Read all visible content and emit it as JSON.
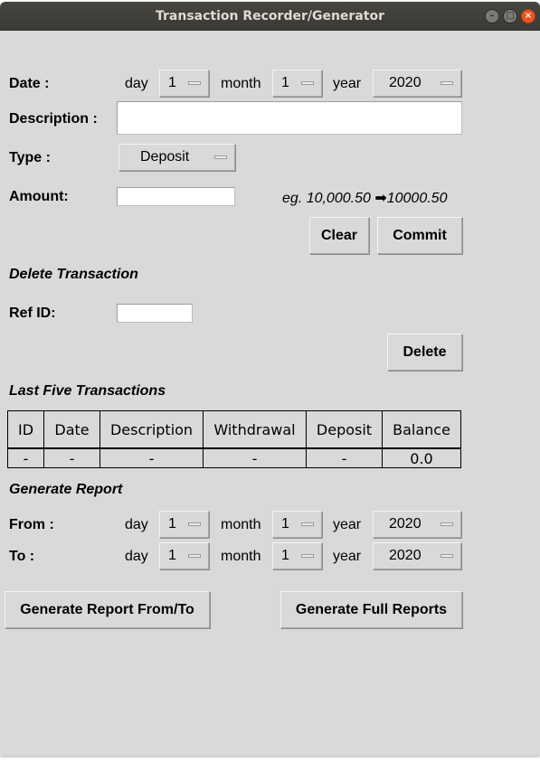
{
  "window": {
    "title": "Transaction Recorder/Generator"
  },
  "date_row": {
    "label": "Date :",
    "day_label": "day",
    "day_value": "1",
    "month_label": "month",
    "month_value": "1",
    "year_label": "year",
    "year_value": "2020"
  },
  "description": {
    "label": "Description :",
    "value": ""
  },
  "type": {
    "label": "Type :",
    "value": "Deposit"
  },
  "amount": {
    "label": "Amount:",
    "value": "",
    "hint_prefix": "eg. 10,000.50",
    "hint_arrow": "➡",
    "hint_suffix": "10000.50"
  },
  "actions": {
    "clear_label": "Clear",
    "commit_label": "Commit"
  },
  "delete_section": {
    "heading": "Delete Transaction",
    "ref_label": "Ref ID:",
    "ref_value": "",
    "delete_label": "Delete"
  },
  "last_five": {
    "heading": "Last Five Transactions",
    "columns": [
      "ID",
      "Date",
      "Description",
      "Withdrawal",
      "Deposit",
      "Balance"
    ],
    "rows": [
      [
        "-",
        "-",
        "-",
        "-",
        "-",
        "0.0"
      ]
    ]
  },
  "report": {
    "heading": "Generate Report",
    "from": {
      "label": "From :",
      "day_label": "day",
      "day_value": "1",
      "month_label": "month",
      "month_value": "1",
      "year_label": "year",
      "year_value": "2020"
    },
    "to": {
      "label": "To :",
      "day_label": "day",
      "day_value": "1",
      "month_label": "month",
      "month_value": "1",
      "year_label": "year",
      "year_value": "2020"
    },
    "from_to_button": "Generate Report From/To",
    "full_button": "Generate Full Reports"
  }
}
